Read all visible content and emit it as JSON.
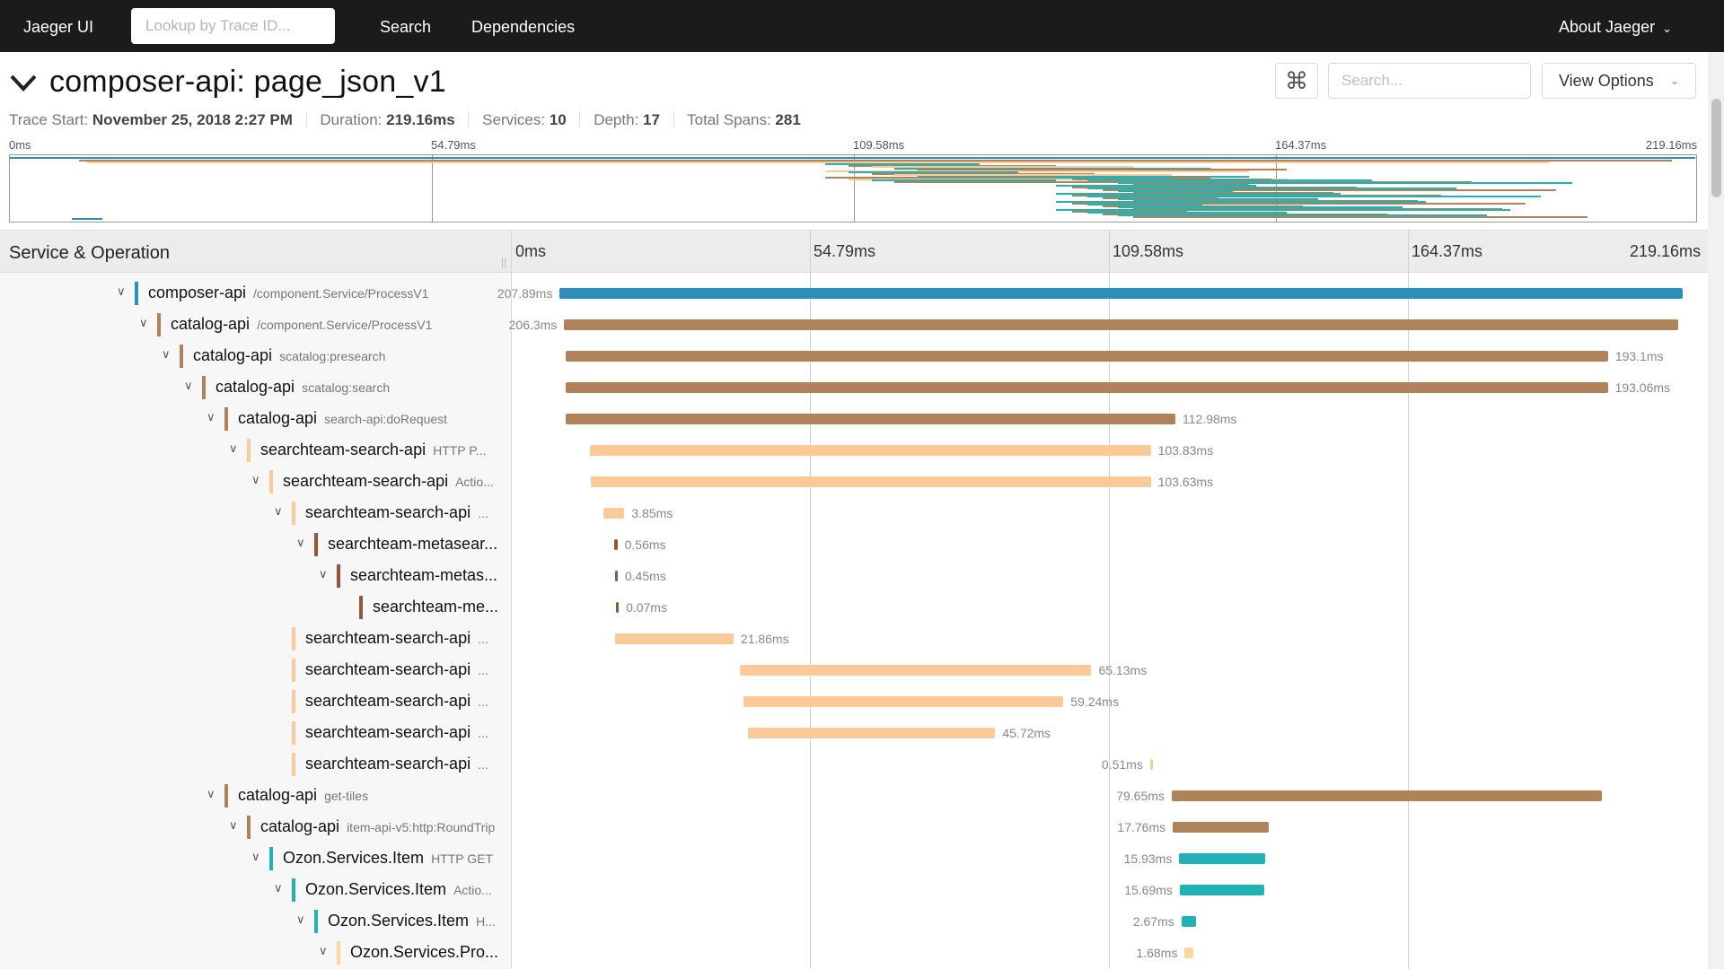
{
  "nav": {
    "brand": "Jaeger UI",
    "lookup_placeholder": "Lookup by Trace ID...",
    "search": "Search",
    "dependencies": "Dependencies",
    "about": "About Jaeger"
  },
  "trace": {
    "title": "composer-api: page_json_v1",
    "search_placeholder": "Search...",
    "view_options": "View Options",
    "meta": {
      "start_label": "Trace Start:",
      "start_value": "November 25, 2018 2:27 PM",
      "duration_label": "Duration:",
      "duration_value": "219.16ms",
      "services_label": "Services:",
      "services_value": "10",
      "depth_label": "Depth:",
      "depth_value": "17",
      "spans_label": "Total Spans:",
      "spans_value": "281"
    }
  },
  "minimap_ticks": [
    "0ms",
    "54.79ms",
    "109.58ms",
    "164.37ms",
    "219.16ms"
  ],
  "timeline": {
    "header_label": "Service & Operation",
    "ticks": [
      "0ms",
      "54.79ms",
      "109.58ms",
      "164.37ms",
      "219.16ms"
    ]
  },
  "colors": {
    "composer": "#2b8fbd",
    "catalog": "#b0825a",
    "searchteam": "#fcc999",
    "metasearch": "#8b5a38",
    "ozon_item": "#20b2b5",
    "ozon_pro": "#fbd79a"
  },
  "spans": [
    {
      "depth": 5,
      "toggle": true,
      "service": "composer-api",
      "op": "/component.Service/ProcessV1",
      "color": "#2b8fbd",
      "start_ms": 8.87,
      "dur_ms": 207.89,
      "dur_label": "207.89ms",
      "label_left": true
    },
    {
      "depth": 6,
      "toggle": true,
      "service": "catalog-api",
      "op": "/component.Service/ProcessV1",
      "color": "#b0825a",
      "start_ms": 9.7,
      "dur_ms": 206.3,
      "dur_label": "206.3ms",
      "label_left": true
    },
    {
      "depth": 7,
      "toggle": true,
      "service": "catalog-api",
      "op": "scatalog:presearch",
      "color": "#b0825a",
      "start_ms": 9.9,
      "dur_ms": 193.1,
      "dur_label": "193.1ms",
      "label_left": false
    },
    {
      "depth": 8,
      "toggle": true,
      "service": "catalog-api",
      "op": "scatalog:search",
      "color": "#b0825a",
      "start_ms": 9.9,
      "dur_ms": 193.06,
      "dur_label": "193.06ms",
      "label_left": false
    },
    {
      "depth": 9,
      "toggle": true,
      "service": "catalog-api",
      "op": "search-api:doRequest",
      "color": "#b0825a",
      "start_ms": 9.9,
      "dur_ms": 112.98,
      "dur_label": "112.98ms",
      "label_left": false
    },
    {
      "depth": 10,
      "toggle": true,
      "service": "searchteam-search-api",
      "op": "HTTP P...",
      "color": "#fcc999",
      "start_ms": 14.5,
      "dur_ms": 103.83,
      "dur_label": "103.83ms",
      "label_left": false
    },
    {
      "depth": 11,
      "toggle": true,
      "service": "searchteam-search-api",
      "op": "Actio...",
      "color": "#fcc999",
      "start_ms": 14.7,
      "dur_ms": 103.63,
      "dur_label": "103.63ms",
      "label_left": false
    },
    {
      "depth": 12,
      "toggle": true,
      "service": "searchteam-search-api",
      "op": "...",
      "color": "#fcc999",
      "start_ms": 17.0,
      "dur_ms": 3.85,
      "dur_label": "3.85ms",
      "label_left": false
    },
    {
      "depth": 13,
      "toggle": true,
      "service": "searchteam-metasear...",
      "op": "",
      "color": "#8b5a38",
      "start_ms": 19.0,
      "dur_ms": 0.56,
      "dur_label": "0.56ms",
      "label_left": false
    },
    {
      "depth": 14,
      "toggle": true,
      "service": "searchteam-metas...",
      "op": "",
      "color": "#8b5a38",
      "start_ms": 19.1,
      "dur_ms": 0.45,
      "dur_label": "0.45ms",
      "label_left": false
    },
    {
      "depth": 15,
      "toggle": false,
      "service": "searchteam-me...",
      "op": "",
      "color": "#8b5a38",
      "start_ms": 19.3,
      "dur_ms": 0.07,
      "dur_label": "0.07ms",
      "label_left": false
    },
    {
      "depth": 12,
      "toggle": false,
      "service": "searchteam-search-api",
      "op": "...",
      "color": "#fcc999",
      "start_ms": 19.2,
      "dur_ms": 21.86,
      "dur_label": "21.86ms",
      "label_left": false
    },
    {
      "depth": 12,
      "toggle": false,
      "service": "searchteam-search-api",
      "op": "...",
      "color": "#fcc999",
      "start_ms": 42.2,
      "dur_ms": 65.13,
      "dur_label": "65.13ms",
      "label_left": false
    },
    {
      "depth": 12,
      "toggle": false,
      "service": "searchteam-search-api",
      "op": "...",
      "color": "#fcc999",
      "start_ms": 42.9,
      "dur_ms": 59.24,
      "dur_label": "59.24ms",
      "label_left": false
    },
    {
      "depth": 12,
      "toggle": false,
      "service": "searchteam-search-api",
      "op": "...",
      "color": "#fcc999",
      "start_ms": 43.8,
      "dur_ms": 45.72,
      "dur_label": "45.72ms",
      "label_left": false
    },
    {
      "depth": 12,
      "toggle": false,
      "service": "searchteam-search-api",
      "op": "...",
      "color": "#fcc999",
      "start_ms": 118.2,
      "dur_ms": 0.51,
      "dur_label": "0.51ms",
      "label_left": true
    },
    {
      "depth": 9,
      "toggle": true,
      "service": "catalog-api",
      "op": "get-tiles",
      "color": "#b0825a",
      "start_ms": 122.2,
      "dur_ms": 79.65,
      "dur_label": "79.65ms",
      "label_left": true
    },
    {
      "depth": 10,
      "toggle": true,
      "service": "catalog-api",
      "op": "item-api-v5:http:RoundTrip",
      "color": "#b0825a",
      "start_ms": 122.4,
      "dur_ms": 17.76,
      "dur_label": "17.76ms",
      "label_left": true
    },
    {
      "depth": 11,
      "toggle": true,
      "service": "Ozon.Services.Item",
      "op": "HTTP GET",
      "color": "#20b2b5",
      "start_ms": 123.6,
      "dur_ms": 15.93,
      "dur_label": "15.93ms",
      "label_left": true
    },
    {
      "depth": 12,
      "toggle": true,
      "service": "Ozon.Services.Item",
      "op": "Actio...",
      "color": "#20b2b5",
      "start_ms": 123.7,
      "dur_ms": 15.69,
      "dur_label": "15.69ms",
      "label_left": true
    },
    {
      "depth": 13,
      "toggle": true,
      "service": "Ozon.Services.Item",
      "op": "H...",
      "color": "#20b2b5",
      "start_ms": 124.0,
      "dur_ms": 2.67,
      "dur_label": "2.67ms",
      "label_left": true
    },
    {
      "depth": 14,
      "toggle": true,
      "service": "Ozon.Services.Pro...",
      "op": "",
      "color": "#fbd79a",
      "start_ms": 124.6,
      "dur_ms": 1.68,
      "dur_label": "1.68ms",
      "label_left": true
    }
  ]
}
